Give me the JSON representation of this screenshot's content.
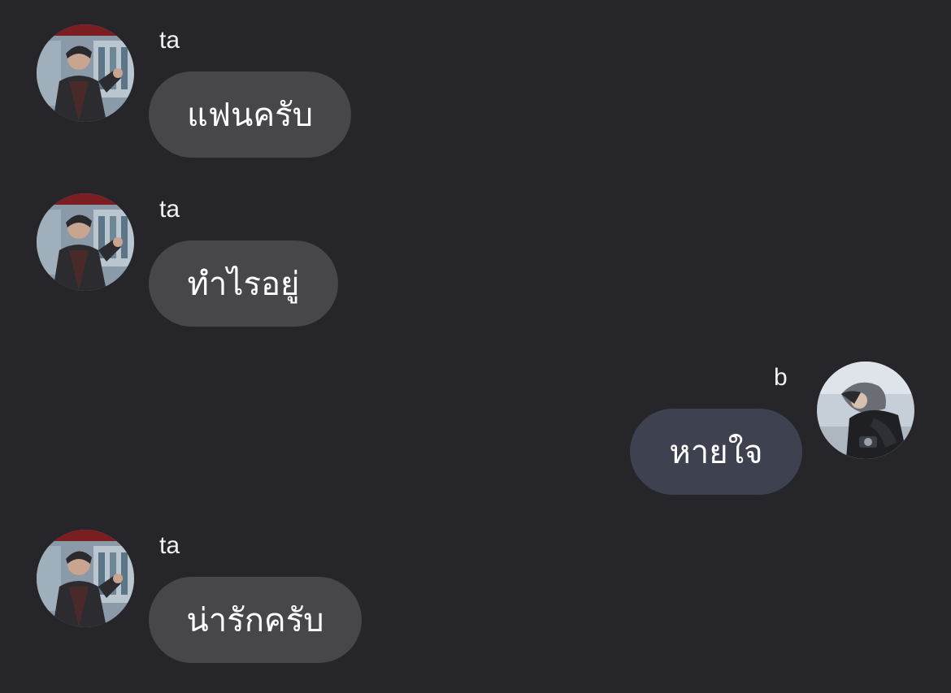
{
  "theme": {
    "background": "#25252a",
    "incoming_bubble": "#46464b",
    "outgoing_bubble": "#3e4250"
  },
  "messages": [
    {
      "sender": "ta",
      "text": "แฟนครับ",
      "direction": "incoming",
      "avatar_icon": "profile-photo-ta"
    },
    {
      "sender": "ta",
      "text": "ทำไรอยู่",
      "direction": "incoming",
      "avatar_icon": "profile-photo-ta"
    },
    {
      "sender": "b",
      "text": "หายใจ",
      "direction": "outgoing",
      "avatar_icon": "profile-photo-b"
    },
    {
      "sender": "ta",
      "text": "น่ารักครับ",
      "direction": "incoming",
      "avatar_icon": "profile-photo-ta"
    }
  ]
}
